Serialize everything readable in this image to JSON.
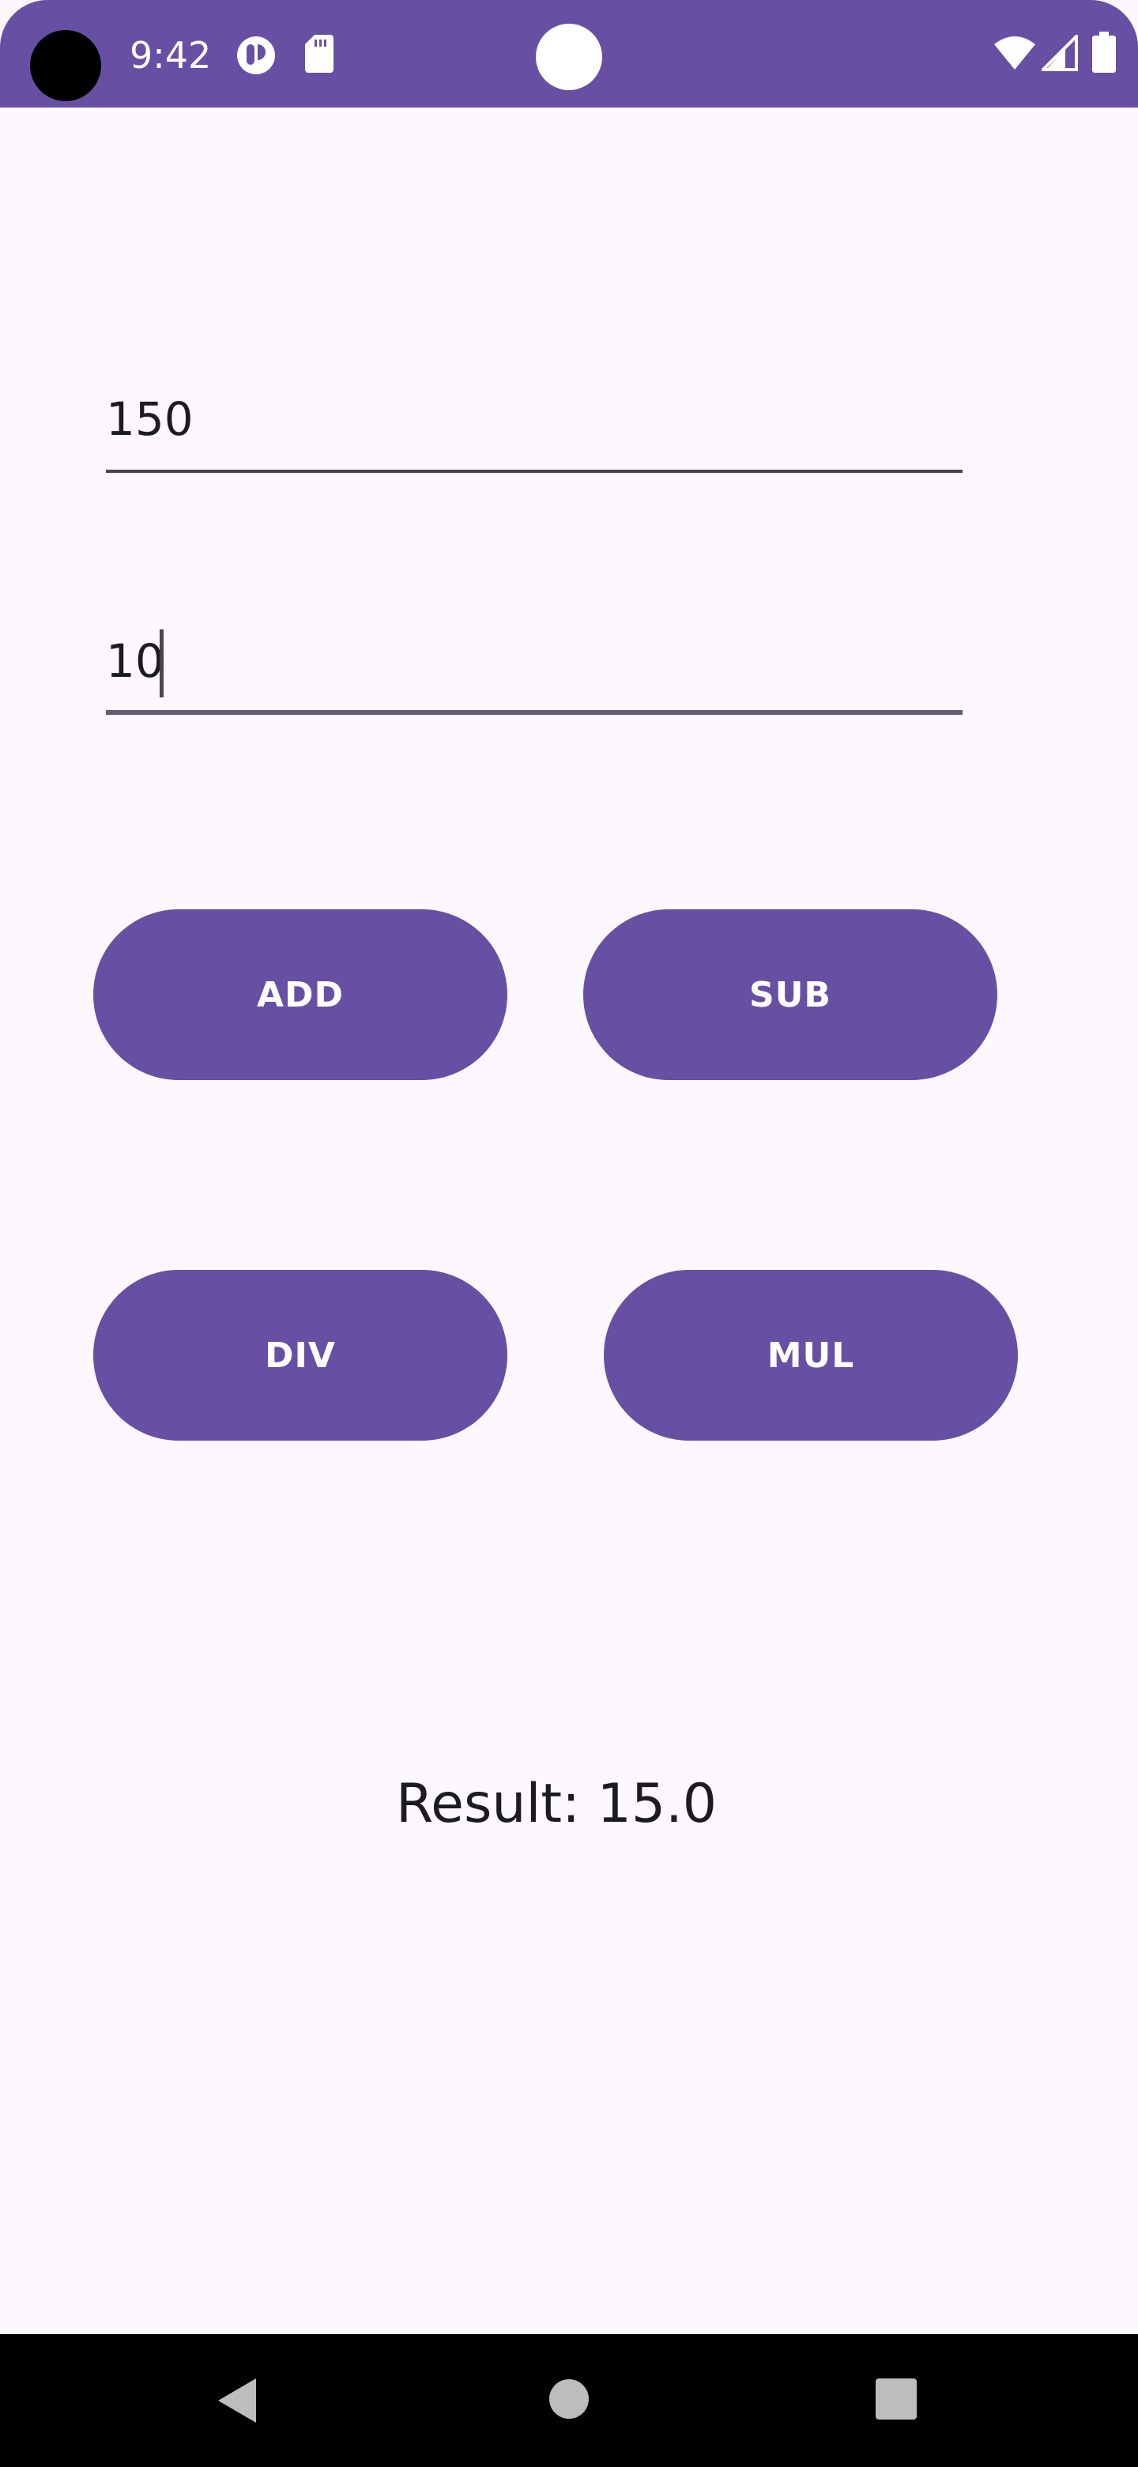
{
  "status_bar": {
    "time": "9:42",
    "icons": [
      "assistant-icon",
      "sd-card-icon",
      "wifi-icon",
      "signal-icon",
      "battery-icon"
    ],
    "background_color": "#6750a4"
  },
  "inputs": {
    "first_number": {
      "value": "150"
    },
    "second_number": {
      "value": "10"
    }
  },
  "buttons": {
    "add": "ADD",
    "sub": "SUB",
    "div": "DIV",
    "mul": "MUL"
  },
  "result": {
    "text": "Result: 15.0"
  },
  "nav_bar": {
    "icons": [
      "back-icon",
      "home-icon",
      "recents-icon"
    ]
  },
  "colors": {
    "accent": "#6750a4",
    "background": "#fdf8fd"
  }
}
